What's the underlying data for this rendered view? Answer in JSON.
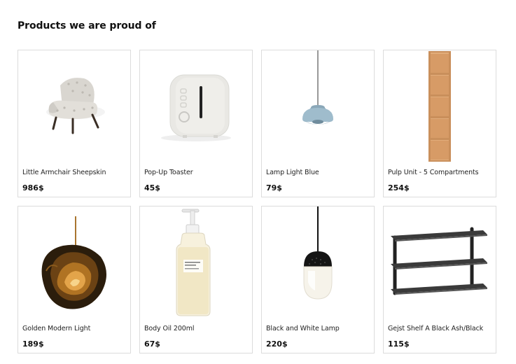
{
  "section": {
    "title": "Products we are proud of"
  },
  "products": [
    {
      "name": "Little Armchair Sheepskin",
      "price": "986$",
      "icon": "armchair-icon"
    },
    {
      "name": "Pop-Up Toaster",
      "price": "45$",
      "icon": "toaster-icon"
    },
    {
      "name": "Lamp Light Blue",
      "price": "79$",
      "icon": "pendant-lamp-blue-icon"
    },
    {
      "name": "Pulp Unit - 5 Compartments",
      "price": "254$",
      "icon": "shelf-unit-icon"
    },
    {
      "name": "Golden Modern Light",
      "price": "189$",
      "icon": "golden-lamp-icon"
    },
    {
      "name": "Body Oil 200ml",
      "price": "67$",
      "icon": "oil-bottle-icon"
    },
    {
      "name": "Black and White Lamp",
      "price": "220$",
      "icon": "black-white-lamp-icon"
    },
    {
      "name": "Gejst Shelf A Black Ash/Black",
      "price": "115$",
      "icon": "wall-shelf-icon"
    }
  ]
}
